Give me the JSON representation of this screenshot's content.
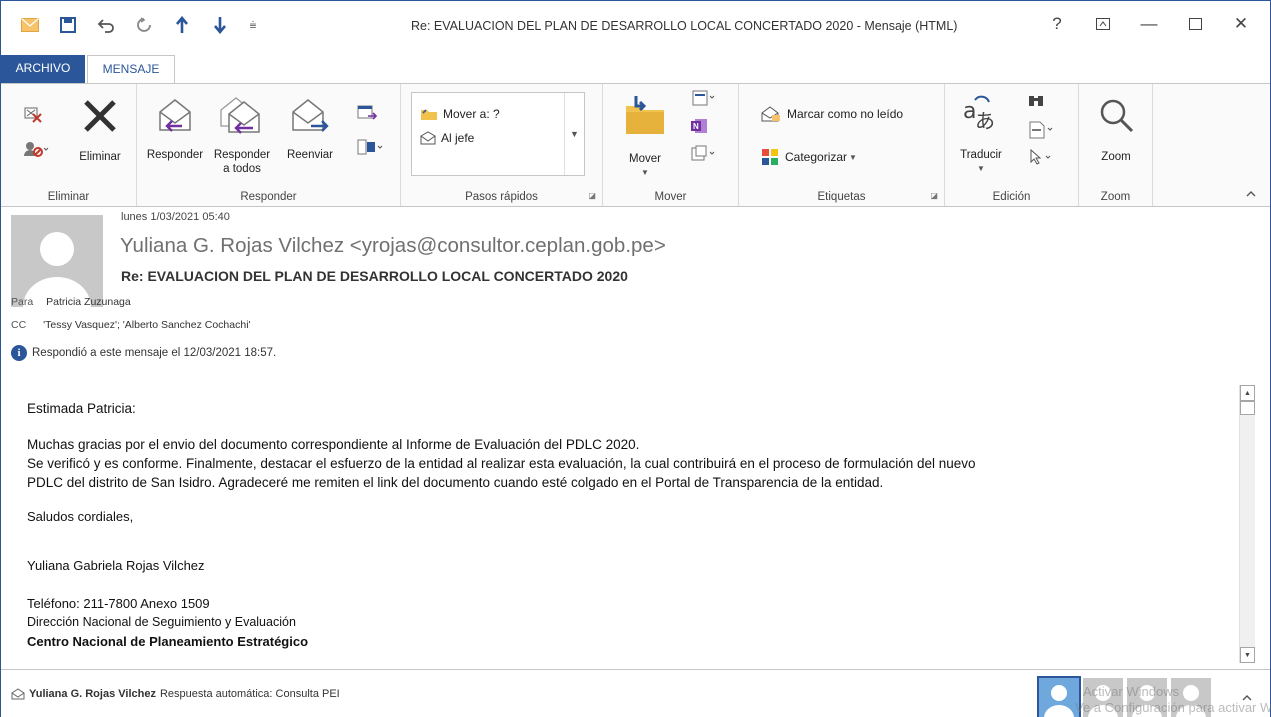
{
  "window": {
    "title": "Re: EVALUACION DEL PLAN DE DESARROLLO LOCAL CONCERTADO 2020 - Mensaje (HTML)",
    "controls": [
      "?",
      "⧉",
      "—",
      "☐",
      "✕"
    ]
  },
  "tabs": [
    {
      "label": "ARCHIVO",
      "active": false
    },
    {
      "label": "MENSAJE",
      "active": true
    }
  ],
  "ribbon": {
    "eliminar": {
      "label": "Eliminar",
      "delete_label": "Eliminar"
    },
    "responder": {
      "label": "Responder",
      "reply": "Responder",
      "reply_all_1": "Responder",
      "reply_all_2": "a todos",
      "forward": "Reenviar"
    },
    "quick_steps": {
      "label": "Pasos rápidos",
      "items": [
        "Mover a: ?",
        "Al jefe"
      ]
    },
    "mover": {
      "label": "Mover",
      "move": "Mover"
    },
    "etiquetas": {
      "label": "Etiquetas",
      "mark_unread": "Marcar como no leído",
      "categorize": "Categorizar"
    },
    "edicion": {
      "label": "Edición",
      "translate": "Traducir"
    },
    "zoom": {
      "label": "Zoom",
      "zoom": "Zoom"
    }
  },
  "message": {
    "date": "lunes 1/03/2021 05:40",
    "sender": "Yuliana G. Rojas Vilchez <yrojas@consultor.ceplan.gob.pe>",
    "subject": "Re: EVALUACION DEL PLAN DE DESARROLLO LOCAL CONCERTADO 2020",
    "to_label": "Para",
    "to": "Patricia Zuzunaga",
    "cc_label": "CC",
    "cc": "'Tessy Vasquez'; 'Alberto  Sanchez Cochachi'",
    "info": "Respondió a este mensaje el 12/03/2021 18:57."
  },
  "body": {
    "greeting": "Estimada Patricia:",
    "line1": "Muchas gracias por el envio del documento correspondiente al Informe de Evaluación del PDLC 2020.",
    "line2": "Se verificó y es conforme. Finalmente, destacar el esfuerzo de la entidad al realizar esta evaluación, la cual contribuirá en el proceso de formulación del nuevo",
    "line3": "PDLC del distrito de San Isidro. Agradeceré me remiten el link del documento cuando esté colgado en el Portal de Transparencia de la entidad.",
    "closing": "Saludos cordiales,",
    "sig_name": "Yuliana Gabriela Rojas Vilchez",
    "sig_phone": "Teléfono: 211-7800  Anexo 1509",
    "sig_dept": "Dirección Nacional de Seguimiento y Evaluación",
    "sig_org": "Centro Nacional de Planeamiento Estratégico"
  },
  "people_pane": {
    "name": "Yuliana G. Rojas Vilchez",
    "text": "Respuesta automática: Consulta PEI",
    "watermark_1": "Activar Windows",
    "watermark_2": "Ve a Configuración para activar W"
  },
  "colors": {
    "accent": "#2b579a",
    "ribbon_bg": "#fafafa"
  }
}
